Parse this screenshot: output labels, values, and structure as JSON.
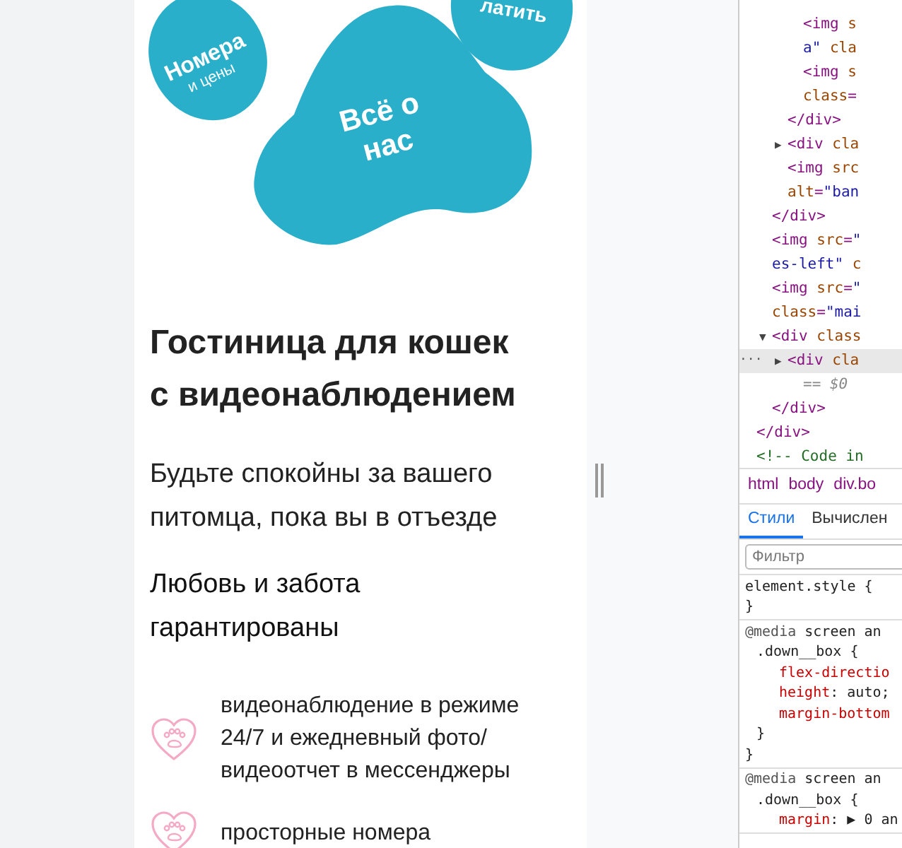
{
  "nav_links": [
    {
      "kind": "small",
      "label": "Номера",
      "sub": "и цены"
    },
    {
      "kind": "big",
      "label": "Всё о\nнас"
    },
    {
      "kind": "corner",
      "label": "латить"
    }
  ],
  "title": "Гостиница для кошек\nс видеонаблюдением",
  "subtitle": "Будьте спокойны за вашего\nпитомца, пока вы в отъезде",
  "section_heading": "Любовь и забота\nгарантированы",
  "features": [
    {
      "text": "видеонаблюдение в режиме\n24/7 и ежедневный фото/\nвидеоотчет в мессенджеры"
    },
    {
      "text": "просторные номера"
    }
  ],
  "devtools": {
    "elements": [
      {
        "children": [
          {
            "children": [
              {
                "children": [
                  {
                    "text": "<img s"
                  },
                  {
                    "text": "a\" cla"
                  },
                  {
                    "text": "<img s"
                  },
                  {
                    "text": "class="
                  }
                ]
              },
              {
                "text": "</div>"
              },
              {
                "text": "<div cla",
                "caret": "▶"
              },
              {
                "text": "<img src"
              },
              {
                "text": "alt=\"ban"
              }
            ]
          },
          {
            "text": "</div>"
          },
          {
            "text": "<img src=\""
          },
          {
            "text": "es-left\" c"
          },
          {
            "text": "<img src=\""
          },
          {
            "text": "class=\"mai"
          },
          {
            "text": "<div class",
            "caret": "▼",
            "children": [
              {
                "text": "<div cla",
                "caret": "▶",
                "selected": true,
                "dots": "···",
                "children": [
                  {
                    "text": "== $0"
                  }
                ]
              }
            ]
          },
          {
            "text": "</div>"
          }
        ]
      },
      {
        "text": "</div>"
      },
      {
        "text": "<!-- Code in"
      }
    ],
    "breadcrumbs": [
      "html",
      "body",
      "div.bo"
    ],
    "tabs": [
      {
        "label": "Стили",
        "selected": true
      },
      {
        "label": "Вычислен",
        "selected": false
      }
    ],
    "filter": {
      "placeholder": "Фильтр"
    },
    "rules": [
      {
        "lines": [
          {
            "text": "element.style {"
          },
          {
            "text": "}"
          }
        ]
      },
      {
        "lines": [
          {
            "text": "@media screen an",
            "children": [
              {
                "text": ".down__box {",
                "children": [
                  {
                    "children": [
                      {
                        "text": "flex-directio"
                      },
                      {
                        "text": "height: auto;"
                      },
                      {
                        "text": "margin-bottom"
                      }
                    ]
                  }
                ]
              },
              {
                "text": "}"
              }
            ]
          },
          {
            "text": "}"
          }
        ]
      },
      {
        "lines": [
          {
            "text": "@media screen an",
            "children": [
              {
                "text": ".down__box {",
                "children": [
                  {
                    "children": [
                      {
                        "text": "margin: ▶ 0 an"
                      }
                    ]
                  }
                ]
              }
            ]
          }
        ]
      }
    ]
  }
}
